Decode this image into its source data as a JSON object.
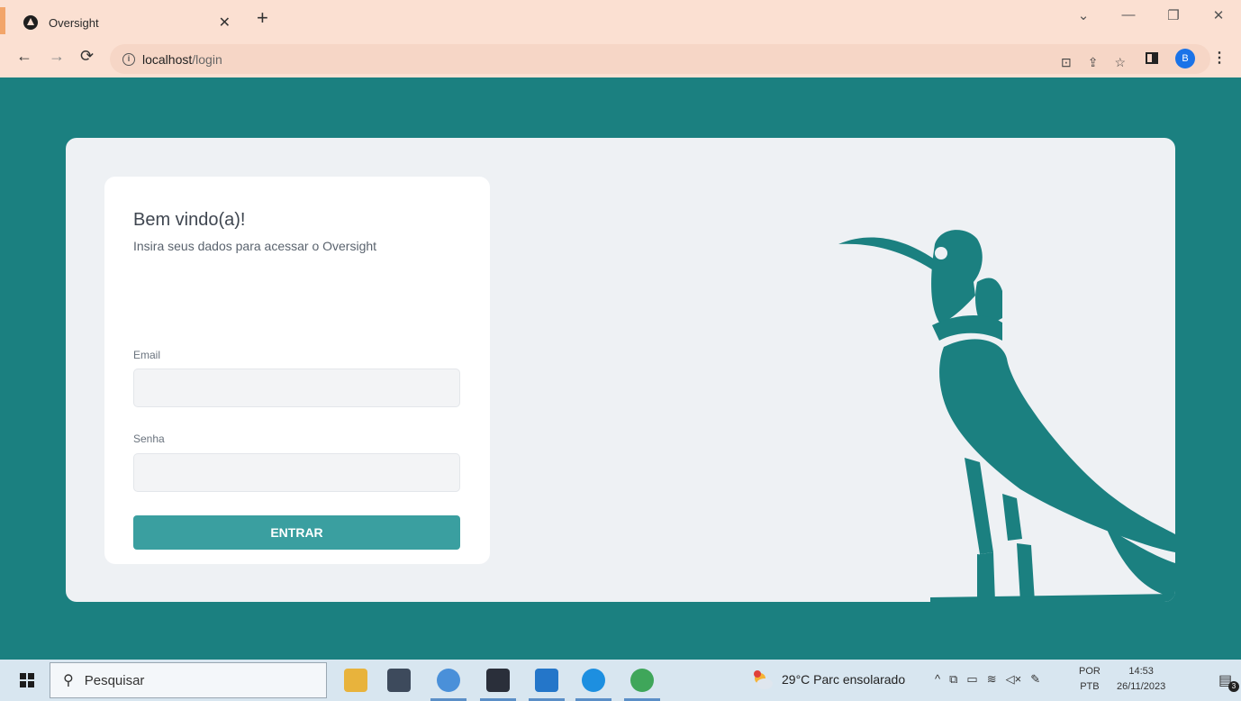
{
  "browser": {
    "tab": {
      "title": "Oversight",
      "icon": "app-triangle-icon"
    },
    "url": {
      "host": "localhost",
      "path": "/login"
    }
  },
  "login": {
    "title": "Bem vindo(a)!",
    "subtitle": "Insira seus dados para acessar o Oversight",
    "email_label": "Email",
    "email_value": "",
    "password_label": "Senha",
    "password_value": "",
    "submit_label": "ENTRAR"
  },
  "profile": {
    "initial": "B"
  },
  "taskbar": {
    "search_placeholder": "Pesquisar",
    "weather": "29°C  Parc ensolarado",
    "lang_primary": "POR",
    "lang_secondary": "PTB",
    "time": "14:53",
    "date": "26/11/2023",
    "notification_count": "3",
    "apps": [
      "file-explorer-icon",
      "microsoft-store-icon",
      "chrome-icon",
      "terminal-icon",
      "vscode-icon",
      "docker-icon",
      "chrome-icon"
    ]
  },
  "colors": {
    "brand_teal": "#1b8080",
    "button_teal": "#3a9fa0",
    "panel_bg": "#eef1f4",
    "chrome_bg": "#fbe0d2"
  }
}
